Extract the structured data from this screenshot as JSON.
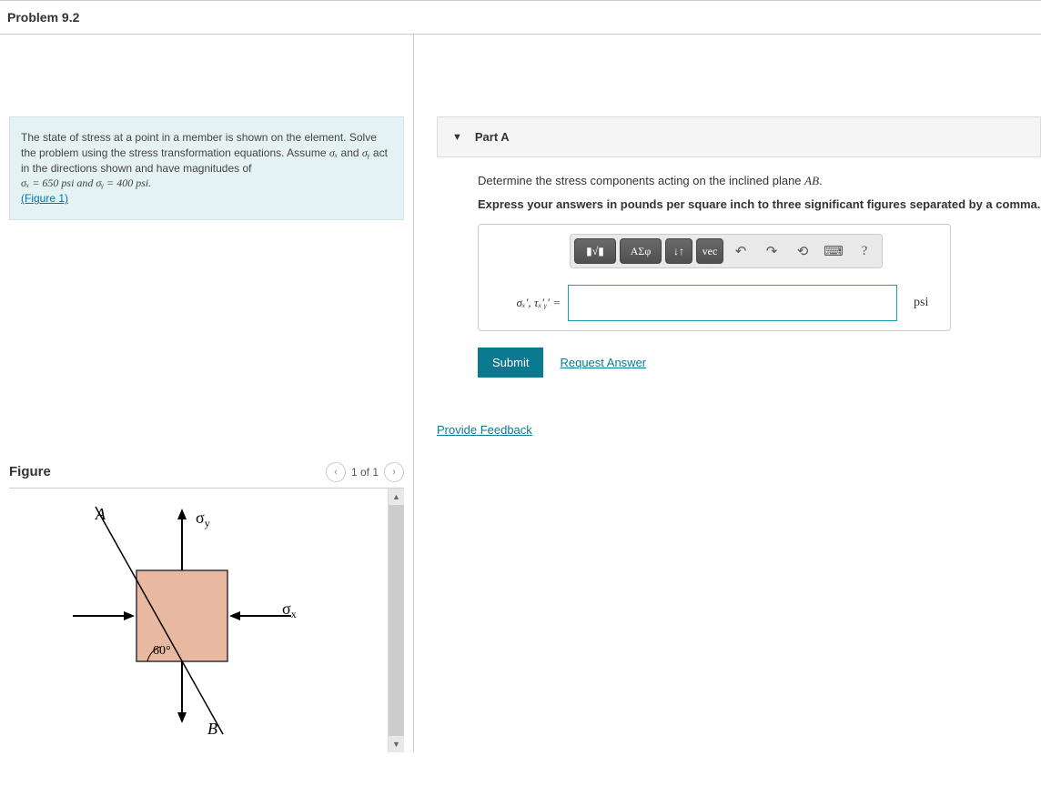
{
  "header": {
    "title": "Problem 9.2"
  },
  "intro": {
    "line1": "The state of stress at a point in a member is shown on the element. Solve the problem using the stress transformation equations. Assume ",
    "line2_pre": " and ",
    "line2_post": " act in the directions shown and have magnitudes of ",
    "sigx_sym": "σₓ",
    "sigy_sym": "σᵧ",
    "vals": "σₓ = 650 psi and σᵧ = 400 psi.",
    "figure_link": "(Figure 1)"
  },
  "figure": {
    "title": "Figure",
    "pager": "1 of 1",
    "labels": {
      "A": "A",
      "B": "B",
      "sigx": "σ",
      "sigx_sub": "x",
      "sigy": "σ",
      "sigy_sub": "y",
      "angle": "60°"
    }
  },
  "partA": {
    "title": "Part A",
    "question_pre": "Determine the stress components acting on the inclined plane ",
    "question_ital": "AB",
    "question_post": ".",
    "instruct": "Express your answers in pounds per square inch to three significant figures separated by a comma.",
    "toolbar": {
      "templates": "▮√▮",
      "greek": "ΑΣφ",
      "subscript": "↓↑",
      "vec": "vec",
      "undo": "↶",
      "redo": "↷",
      "reset": "⟲",
      "keyboard": "⌨",
      "help": "?"
    },
    "input_label": "σₓ′, τₓ′ᵧ′ =",
    "unit": "psi",
    "submit": "Submit",
    "request": "Request Answer"
  },
  "feedback": "Provide Feedback"
}
